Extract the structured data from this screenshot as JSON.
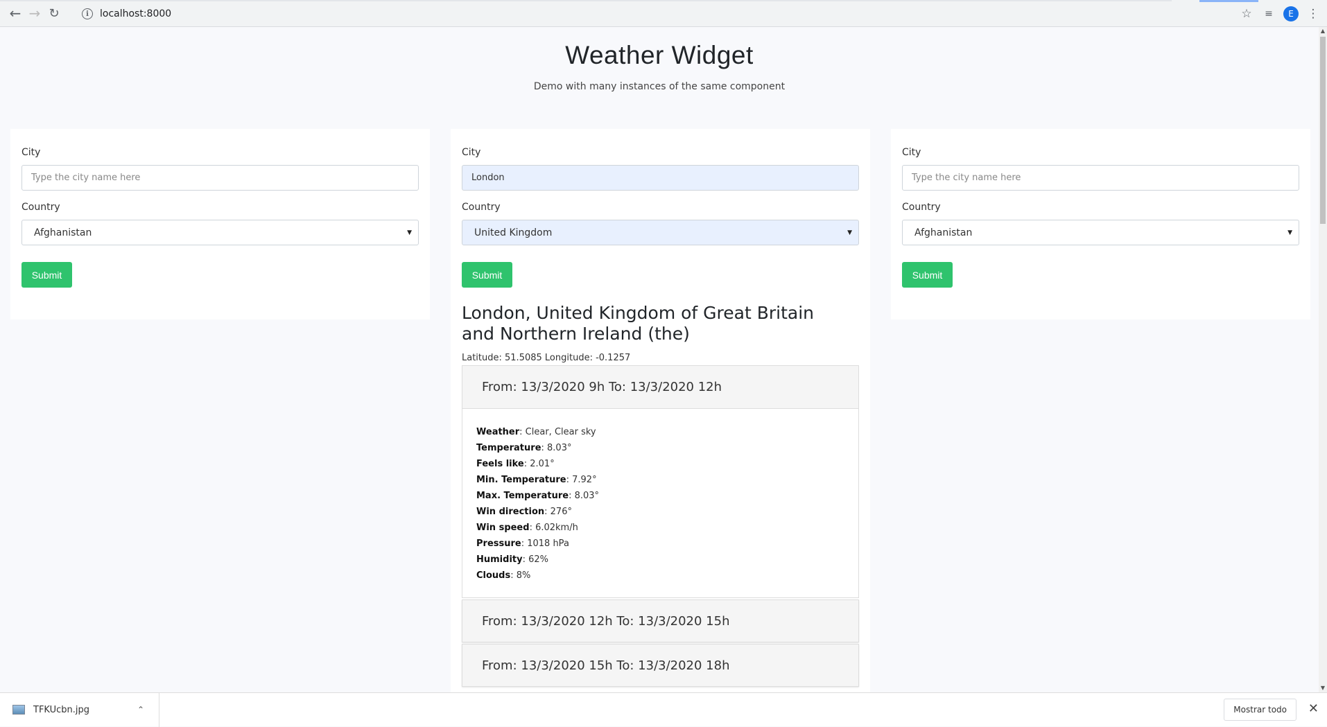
{
  "browser": {
    "url": "localhost:8000",
    "avatar_letter": "E"
  },
  "header": {
    "title": "Weather Widget",
    "subtitle": "Demo with many instances of the same component"
  },
  "widgets": [
    {
      "city_label": "City",
      "city_placeholder": "Type the city name here",
      "country_label": "Country",
      "country_value": "Afghanistan",
      "submit_label": "Submit"
    },
    {
      "city_label": "City",
      "city_value": "London",
      "country_label": "Country",
      "country_value": "United Kingdom",
      "submit_label": "Submit",
      "result": {
        "title": "London, United Kingdom of Great Britain and Northern Ireland (the)",
        "coords": "Latitude: 51.5085 Longitude: -0.1257",
        "forecasts": [
          {
            "heading": "From: 13/3/2020 9h To: 13/3/2020 12h",
            "rows": [
              {
                "label": "Weather",
                "value": ": Clear, Clear sky"
              },
              {
                "label": "Temperature",
                "value": ": 8.03°"
              },
              {
                "label": "Feels like",
                "value": ": 2.01°"
              },
              {
                "label": "Min. Temperature",
                "value": ": 7.92°"
              },
              {
                "label": "Max. Temperature",
                "value": ": 8.03°"
              },
              {
                "label": "Win direction",
                "value": ": 276°"
              },
              {
                "label": "Win speed",
                "value": ": 6.02km/h"
              },
              {
                "label": "Pressure",
                "value": ": 1018 hPa"
              },
              {
                "label": "Humidity",
                "value": ": 62%"
              },
              {
                "label": "Clouds",
                "value": ": 8%"
              }
            ]
          },
          {
            "heading": "From: 13/3/2020 12h To: 13/3/2020 15h"
          },
          {
            "heading": "From: 13/3/2020 15h To: 13/3/2020 18h"
          }
        ]
      }
    },
    {
      "city_label": "City",
      "city_placeholder": "Type the city name here",
      "country_label": "Country",
      "country_value": "Afghanistan",
      "submit_label": "Submit"
    }
  ],
  "download_shelf": {
    "file_name": "TFKUcbn.jpg",
    "show_all_label": "Mostrar todo"
  },
  "icons": {
    "back": "back-arrow-icon",
    "forward": "forward-arrow-icon",
    "reload": "reload-icon",
    "info": "info-icon",
    "star": "star-icon",
    "media": "media-control-icon",
    "menu": "kebab-menu-icon"
  }
}
